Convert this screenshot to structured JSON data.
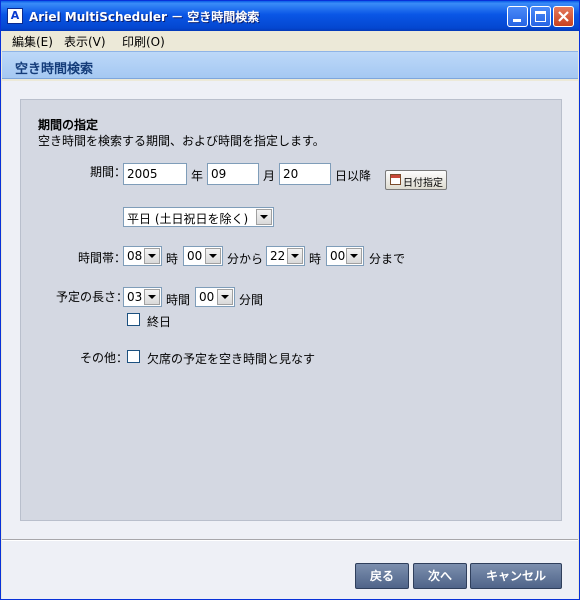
{
  "window": {
    "title": "Ariel MultiScheduler － 空き時間検索",
    "icon_letter": "A"
  },
  "menu": {
    "items": [
      "編集(E)",
      "表示(V)",
      "印刷(O)"
    ]
  },
  "header": {
    "title": "空き時間検索"
  },
  "section": {
    "title": "期間の指定",
    "description": "空き時間を検索する期間、および時間を指定します。"
  },
  "period": {
    "label": "期間：",
    "year": "2005",
    "year_unit": "年",
    "month": "09",
    "month_unit": "月",
    "day": "20",
    "day_unit": "日以降",
    "date_button": "日付指定",
    "day_filter": "平日 (土日祝日を除く)"
  },
  "time_range": {
    "label": "時間帯：",
    "from_hour": "08",
    "hour_unit1": "時",
    "from_min": "00",
    "from_suffix": "分から",
    "to_hour": "22",
    "hour_unit2": "時",
    "to_min": "00",
    "to_suffix": "分まで"
  },
  "duration": {
    "label": "予定の長さ：",
    "hours": "03",
    "hours_unit": "時間",
    "minutes": "00",
    "minutes_unit": "分間",
    "all_day_label": "終日",
    "all_day_checked": false
  },
  "other": {
    "label": "その他：",
    "absent_label": "欠席の予定を空き時間と見なす",
    "absent_checked": false
  },
  "buttons": {
    "back": "戻る",
    "next": "次へ",
    "cancel": "キャンセル"
  },
  "colors": {
    "titlebar": "#0a56e6",
    "header_bg": "#b3d0f5",
    "panel_bg": "#d4d8e2",
    "button_bg": "#5f7396"
  }
}
